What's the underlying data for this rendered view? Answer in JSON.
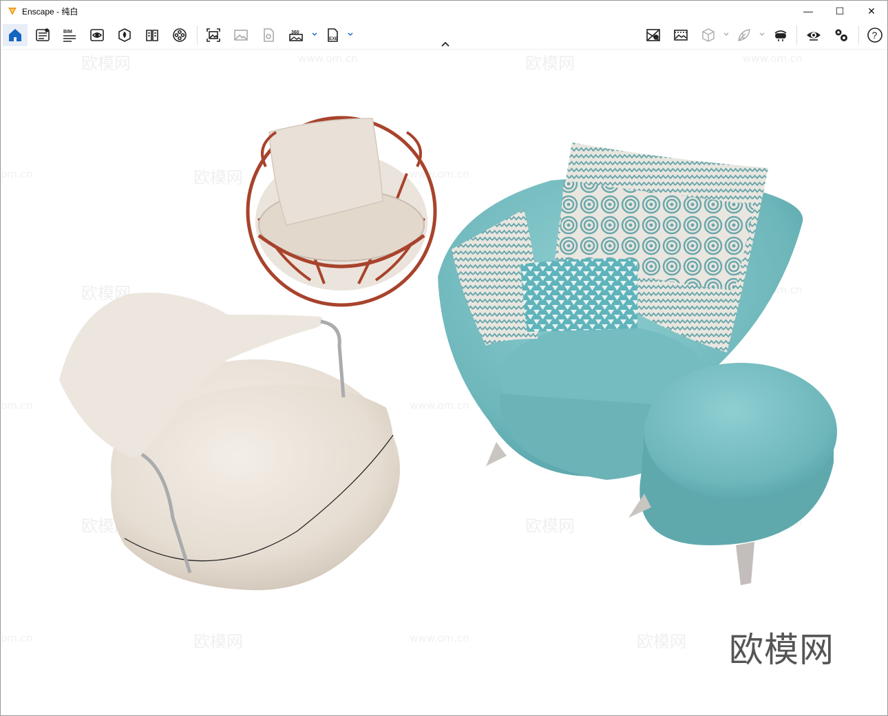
{
  "window": {
    "title": "Enscape - 纯白",
    "minimize_glyph": "—",
    "maximize_glyph": "☐",
    "close_glyph": "✕"
  },
  "toolbar": {
    "left_icons": [
      "home-icon",
      "settings-list-icon",
      "bim-icon",
      "visibility-icon",
      "location-icon",
      "book-icon",
      "video-reel-icon",
      "screenshot-icon",
      "image-icon",
      "exe-file-icon",
      "panorama-360-icon",
      "export-exe-icon"
    ],
    "bim_label": "BIM",
    "pano_label": "360",
    "exe_label": "EXE",
    "right_icons": [
      "map-pin-icon",
      "gallery-icon",
      "cube-icon",
      "leaf-icon",
      "vr-headset-icon",
      "eye-icon",
      "gears-icon",
      "help-icon"
    ],
    "help_label": "?",
    "active_color": "#1565c0"
  },
  "viewport": {
    "watermark_text": "欧模网",
    "watermark_url": "www.om.cn",
    "watermark_url_partial": "om.cn",
    "objects": [
      "white-armchair",
      "rattan-ball-chair",
      "teal-armchair",
      "teal-ottoman"
    ],
    "colors": {
      "teal_fabric": "#6fb9bd",
      "beige_fabric": "#e8e1d8",
      "rattan": "#a8432c"
    }
  }
}
